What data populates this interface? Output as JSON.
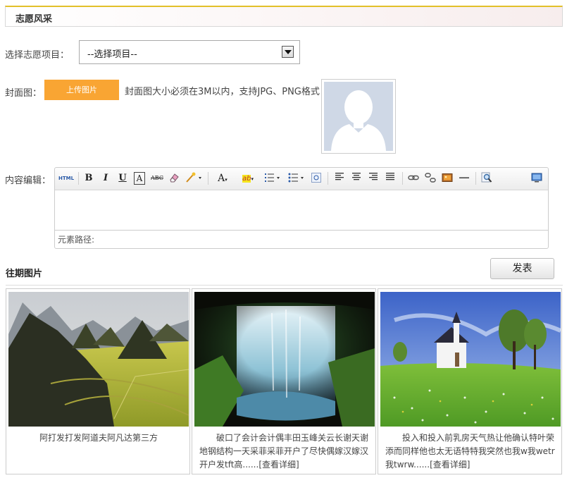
{
  "header": {
    "title": "志愿风采"
  },
  "form": {
    "project_label": "选择志愿项目：",
    "project_select_value": "--选择项目--",
    "cover_label": "封面图：",
    "upload_button": "上传图片",
    "upload_hint": "封面图大小必须在3M以内，支持JPG、PNG格式",
    "content_label": "内容编辑：",
    "editor": {
      "toolbar": {
        "html": "HTML",
        "bold": "B",
        "italic": "I",
        "underline": "U",
        "box_a": "A",
        "strike": "ABC",
        "font_color": "A",
        "highlight": "ab"
      },
      "path_label": "元素路径:"
    }
  },
  "gallery": {
    "title": "往期图片",
    "submit_button": "发表",
    "items": [
      {
        "description": "阿打发打发阿道夫阿凡达第三方"
      },
      {
        "description": "破口了会计会计偶丰田玉峰关云长谢天谢地钢结构一天采菲采菲开户了尽快偶嫁汉嫁汉开户发tft高......",
        "more": "[查看详细]"
      },
      {
        "description": "投入和投入前乳房天气热让他确认特叶荣添而同样他也太无语特特我突然也我w我wetr我twrw......",
        "more": "[查看详细]"
      }
    ]
  },
  "colors": {
    "accent_orange": "#f9a533",
    "header_border": "#e2c02a"
  }
}
